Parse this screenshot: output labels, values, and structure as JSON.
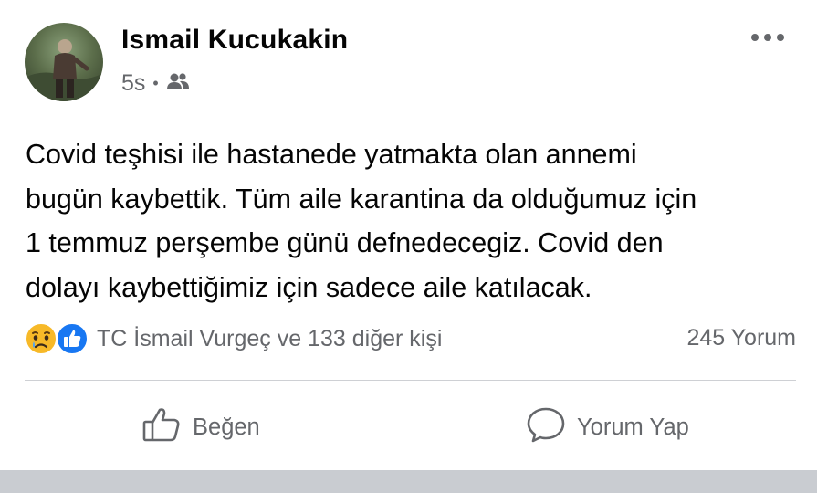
{
  "post": {
    "author": "Ismail Kucukakin",
    "timestamp": "5s",
    "separator": "•",
    "audience_icon": "friends-icon",
    "more_icon": "more-options-icon",
    "text": "Covid teşhisi ile hastanede yatmakta olan annemi\nbugün kaybettik. Tüm aile karantina da olduğumuz için\n1 temmuz perşembe günü defnedecegiz. Covid den\ndolayı kaybettiğimiz için sadece aile katılacak.",
    "reactions": {
      "icons": [
        "sad-reaction-icon",
        "like-reaction-icon"
      ],
      "summary": "TC İsmail Vurgeç ve 133 diğer kişi",
      "comments": "245 Yorum"
    },
    "actions": {
      "like_label": "Beğen",
      "comment_label": "Yorum Yap"
    }
  },
  "colors": {
    "text_primary": "#050505",
    "text_secondary": "#65676b",
    "like_blue": "#1877f2",
    "sad_yellow": "#f7b928",
    "divider": "#ced0d4",
    "bottom_bar": "#c9ccd1"
  }
}
